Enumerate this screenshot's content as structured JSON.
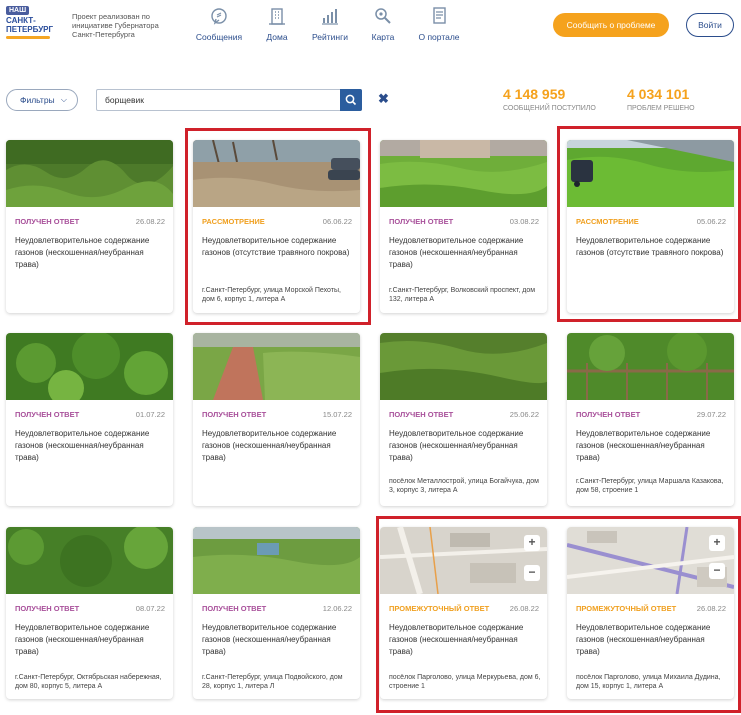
{
  "header": {
    "logo_line1": "НАШ",
    "logo_line2": "САНКТ-ПЕТЕРБУРГ",
    "project_text": "Проект реализован по инициативе Губернатора Санкт-Петербурга",
    "nav": [
      {
        "label": "Сообщения",
        "icon": "messages-icon"
      },
      {
        "label": "Дома",
        "icon": "building-icon"
      },
      {
        "label": "Рейтинги",
        "icon": "ratings-icon"
      },
      {
        "label": "Карта",
        "icon": "map-search-icon"
      },
      {
        "label": "О портале",
        "icon": "document-icon"
      }
    ],
    "report_button": "Сообщить о проблеме",
    "login_button": "Войти"
  },
  "toolbar": {
    "filters_label": "Фильтры",
    "search_value": "борщевик",
    "clear_symbol": "✖"
  },
  "stats": [
    {
      "value": "4 148 959",
      "caption": "СООБЩЕНИЙ ПОСТУПИЛО"
    },
    {
      "value": "4 034 101",
      "caption": "ПРОБЛЕМ РЕШЕНО"
    }
  ],
  "colors": {
    "status_answered": "#a8509a",
    "status_review": "#f0a020",
    "highlight_frame": "#d0212a",
    "accent": "#f5a21d",
    "brand": "#2b4d8c"
  },
  "cards": [
    {
      "status": "ПОЛУЧЕН ОТВЕТ",
      "status_kind": "answered",
      "date": "26.08.22",
      "title": "Неудовлетворительное содержание газонов (нескошенная/неубранная трава)",
      "address": ""
    },
    {
      "status": "РАССМОТРЕНИЕ",
      "status_kind": "review",
      "date": "06.06.22",
      "title": "Неудовлетворительное содержание газонов (отсутствие травяного покрова)",
      "address": "г.Санкт-Петербург, улица Морской Пехоты, дом 6, корпус 1, литера А"
    },
    {
      "status": "ПОЛУЧЕН ОТВЕТ",
      "status_kind": "answered",
      "date": "03.08.22",
      "title": "Неудовлетворительное содержание газонов (нескошенная/неубранная трава)",
      "address": "г.Санкт-Петербург, Волковский проспект, дом 132, литера А"
    },
    {
      "status": "РАССМОТРЕНИЕ",
      "status_kind": "review",
      "date": "05.06.22",
      "title": "Неудовлетворительное содержание газонов (отсутствие травяного покрова)",
      "address": ""
    },
    {
      "status": "ПОЛУЧЕН ОТВЕТ",
      "status_kind": "answered",
      "date": "01.07.22",
      "title": "Неудовлетворительное содержание газонов (нескошенная/неубранная трава)",
      "address": ""
    },
    {
      "status": "ПОЛУЧЕН ОТВЕТ",
      "status_kind": "answered",
      "date": "15.07.22",
      "title": "Неудовлетворительное содержание газонов (нескошенная/неубранная трава)",
      "address": ""
    },
    {
      "status": "ПОЛУЧЕН ОТВЕТ",
      "status_kind": "answered",
      "date": "25.06.22",
      "title": "Неудовлетворительное содержание газонов (нескошенная/неубранная трава)",
      "address": "посёлок Металлострой, улица Богайчука, дом 3, корпус 3, литера А"
    },
    {
      "status": "ПОЛУЧЕН ОТВЕТ",
      "status_kind": "answered",
      "date": "29.07.22",
      "title": "Неудовлетворительное содержание газонов (нескошенная/неубранная трава)",
      "address": "г.Санкт-Петербург, улица Маршала Казакова, дом 58, строение 1"
    },
    {
      "status": "ПОЛУЧЕН ОТВЕТ",
      "status_kind": "answered",
      "date": "08.07.22",
      "title": "Неудовлетворительное содержание газонов (нескошенная/неубранная трава)",
      "address": "г.Санкт-Петербург, Октябрьская набережная, дом 80, корпус 5, литера А"
    },
    {
      "status": "ПОЛУЧЕН ОТВЕТ",
      "status_kind": "answered",
      "date": "12.06.22",
      "title": "Неудовлетворительное содержание газонов (нескошенная/неубранная трава)",
      "address": "г.Санкт-Петербург, улица Подвойского, дом 28, корпус 1, литера Л"
    },
    {
      "status": "ПРОМЕЖУТОЧНЫЙ ОТВЕТ",
      "status_kind": "review",
      "date": "26.08.22",
      "title": "Неудовлетворительное содержание газонов (нескошенная/неубранная трава)",
      "address": "посёлок Парголово, улица Меркурьева, дом 6, строение 1"
    },
    {
      "status": "ПРОМЕЖУТОЧНЫЙ ОТВЕТ",
      "status_kind": "review",
      "date": "26.08.22",
      "title": "Неудовлетворительное содержание газонов (нескошенная/неубранная трава)",
      "address": "посёлок Парголово, улица Михаила Дудина, дом 15, корпус 1, литера А"
    }
  ],
  "map_controls": {
    "zoom_in": "+",
    "zoom_out": "−"
  }
}
